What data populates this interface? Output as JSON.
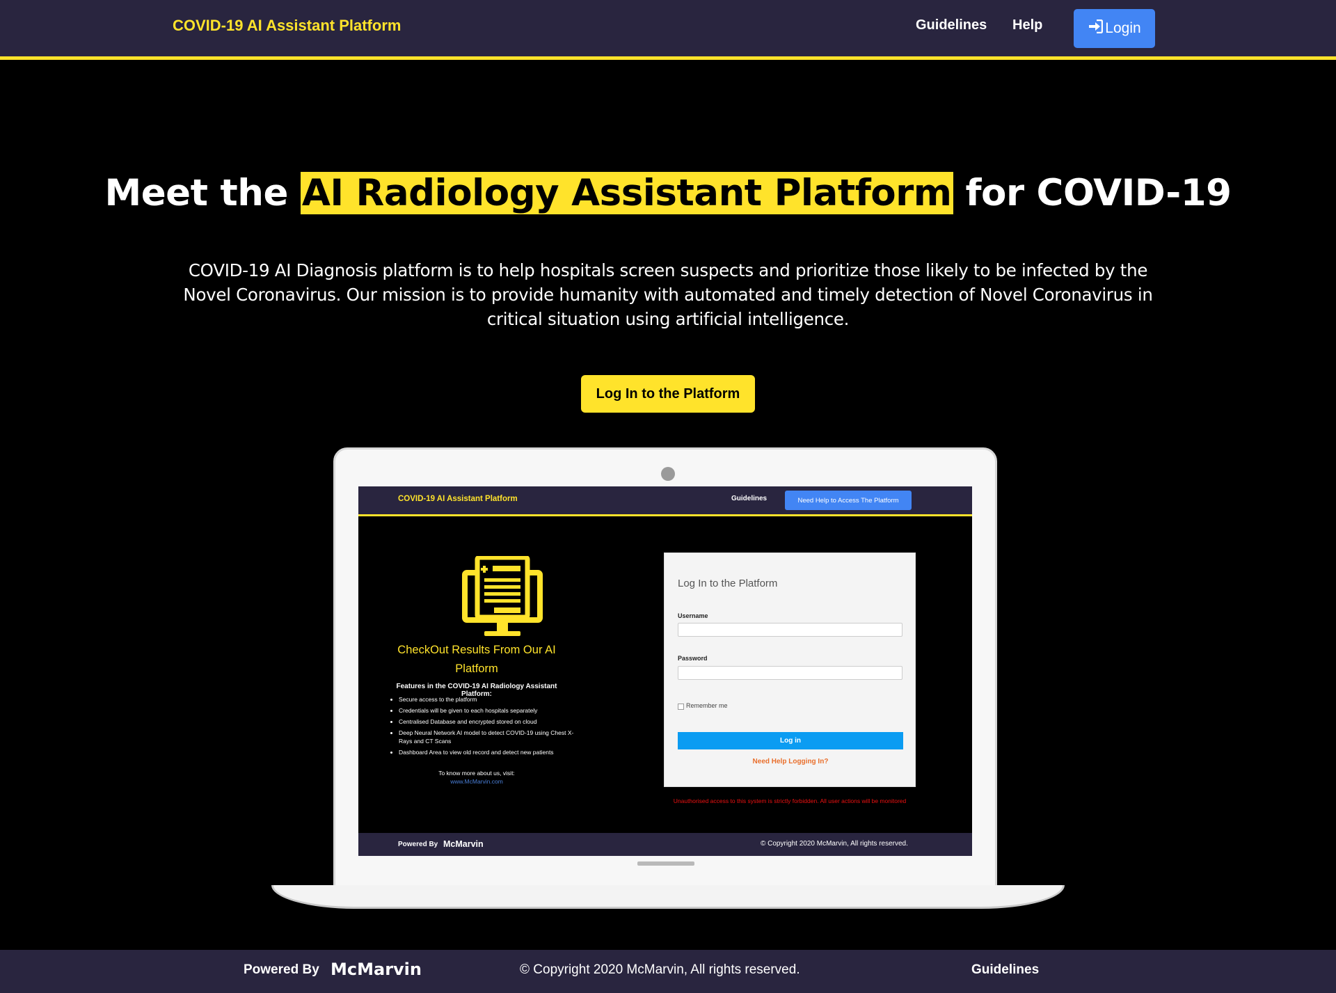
{
  "nav": {
    "brand": "COVID-19 AI Assistant Platform",
    "links": [
      "Guidelines",
      "Help"
    ],
    "login_label": "Login",
    "login_icon": "sign-in-icon"
  },
  "hero": {
    "title_before": "Meet the ",
    "title_highlight": "AI Radiology Assistant Platform",
    "title_after": " for COVID-19",
    "description": "COVID-19 AI Diagnosis platform is to help hospitals screen suspects and prioritize those likely to be infected by the Novel Coronavirus. Our mission is to provide humanity with automated and timely detection of Novel Coronavirus in critical situation using artificial intelligence.",
    "cta_label": "Log In to the Platform"
  },
  "preview": {
    "nav": {
      "brand": "COVID-19 AI Assistant Platform",
      "guidelines": "Guidelines",
      "help_button": "Need Help to Access The Platform"
    },
    "left": {
      "icon": "medical-report-monitor-icon",
      "checkout_title": "CheckOut Results From Our AI Platform",
      "features_title": "Features in the COVID-19 AI Radiology Assistant Platform:",
      "features": [
        "Secure access to the platform",
        "Credentials will be given to each hospitals separately",
        "Centralised Database and encrypted stored on cloud",
        "Deep Neural Network AI model to detect COVID-19 using Chest X-Rays and CT Scans",
        "Dashboard Area to view old record and detect new patients"
      ],
      "know_more": "To know more about us, visit:",
      "website": "www.McMarvin.com"
    },
    "login_card": {
      "title": "Log In to the Platform",
      "username_label": "Username",
      "password_label": "Password",
      "remember_label": "Remember me",
      "login_button": "Log in",
      "help_link": "Need Help Logging In?"
    },
    "warning": "Unauthorised access to this system is strictly forbidden. All user actions will be monitored",
    "footer": {
      "powered_by": "Powered By",
      "logo": "McMarvin",
      "copyright": "© Copyright 2020 McMarvin, All rights reserved."
    }
  },
  "footer": {
    "powered_by": "Powered By",
    "logo": "McMarvin",
    "copyright": "© Copyright 2020 McMarvin, All rights reserved.",
    "guidelines": "Guidelines"
  },
  "colors": {
    "nav_bg": "#29253f",
    "accent_yellow": "#ffe32b",
    "button_blue": "#4285f4",
    "login_blue": "#0b9cf2",
    "help_orange": "#e96f2c",
    "warning_red": "#ee1111"
  }
}
